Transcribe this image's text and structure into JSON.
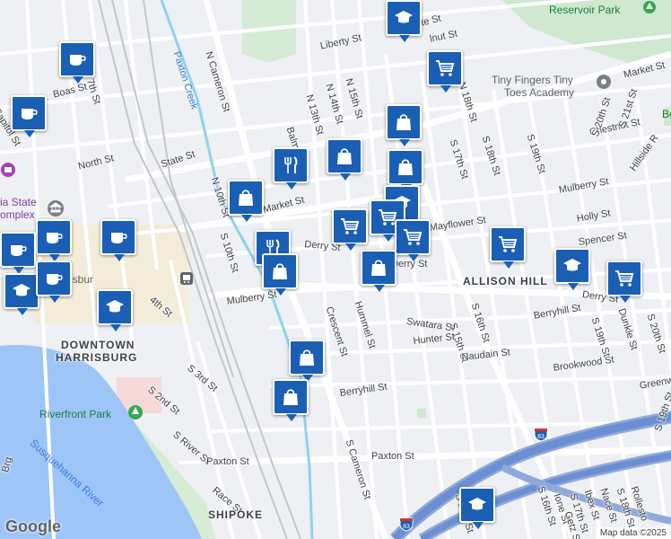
{
  "map": {
    "attribution": "Map data ©2025",
    "logo": "Google",
    "streets": {
      "liberty_st": "Liberty St",
      "state_st_top": "State St",
      "state_st": "State St",
      "n_cameron_st": "N Cameron St",
      "paxton_creek": "Paxton Creek",
      "boas_st": "Boas St",
      "capitol_st": "Capitol St",
      "n_7th_st": "N 7th St",
      "north_st": "North St",
      "n_13th_st": "N 13th St",
      "n_14th_st": "N 14th St",
      "n_15th_st": "N 15th St",
      "walnut_st": "lnut St",
      "balm_st": "Balm",
      "n_18th_st": "N 18th St",
      "s_17th_st": "S 17th St",
      "s_18th_st": "S 18th St",
      "chestnut_st": "Chestnut St",
      "s_19th_st": "S 19th St",
      "s_20th_st": "S 20th St",
      "s_21st_st": "S 21st St",
      "market_st_right": "Market St",
      "market_st": "Market St",
      "mulberry_st_right": "Mulberry St",
      "hillside_rd": "Hillside R",
      "holly_st": "Holly St",
      "mayflower_st": "Mayflower St",
      "spencer_st": "Spencer St",
      "derry_st": "Derry St",
      "derry_st_mid": "Derry St",
      "derry_st_right": "Derry St",
      "s_10th_st": "S 10th St",
      "n_10th_st": "N 10th St",
      "mulberry_st": "Mulberry St",
      "s_4th_st": "4th St",
      "crescent_st": "Crescent St",
      "hummel_st": "Hummel St",
      "swatara_st": "Swatara St",
      "s_16th_st": "S 16th St",
      "s_15th_st": "S 15th St",
      "hunter_st": "Hunter St",
      "berryhill_st_right": "Berryhill St",
      "naudain_st": "Naudain St",
      "brookwood_st": "Brookwood St",
      "s_19th_st_lower": "S 19th St",
      "dunkle_st": "Dunkle St",
      "s_20th_st_lower": "S 20th St",
      "greenwood_st": "Greenw",
      "s_3rd_st": "S 3rd St",
      "s_2nd_st": "S 2nd St",
      "berryhill_st": "Berryhill St",
      "s_river_st": "S River St",
      "paxton_st_left": "Paxton St",
      "paxton_st": "Paxton St",
      "race_st": "Race St",
      "s_cameron_st": "S Cameron St",
      "s_13th_st": "S 13th St",
      "s_16th_st_lower": "S 16th St",
      "ione_st": "Ione St",
      "s_17th_st_lower": "S 17th St",
      "ibex_st": "Ibex St",
      "getz_st": "Getz St",
      "nace_st": "Nace St",
      "s_18th_st_lower": "S 18th St",
      "s_19th_st_bottom": "S 19th St",
      "rolleston_st": "Rollesto",
      "bridge": "Brg"
    },
    "areas": {
      "downtown_line1": "DOWNTOWN",
      "downtown_line2": "HARRISBURG",
      "allison_hill": "ALLISON HILL",
      "shipoke": "SHIPOKE"
    },
    "water": {
      "river": "Susquehanna River"
    },
    "parks": {
      "reservoir_park": "Reservoir Park",
      "riverfront_park": "Riverfront Park",
      "right_edge": "Be"
    },
    "pois": {
      "tiny_fingers_line1": "Tiny Fingers Tiny",
      "tiny_fingers_line2": "Toes Academy",
      "capitol_line1": "ia State",
      "capitol_line2": "omplex",
      "harrisburg_partial": "isbur"
    },
    "highways": {
      "i83_east": "83",
      "i83_south": "83"
    },
    "pins": [
      {
        "type": "education",
        "icon": "graduation-cap-icon"
      },
      {
        "type": "cafe",
        "icon": "coffee-cup-icon"
      },
      {
        "type": "cafe",
        "icon": "coffee-cup-icon"
      },
      {
        "type": "shopping",
        "icon": "shopping-cart-icon"
      },
      {
        "type": "store",
        "icon": "shopping-bag-icon"
      },
      {
        "type": "store",
        "icon": "shopping-bag-icon"
      },
      {
        "type": "store",
        "icon": "shopping-bag-icon"
      },
      {
        "type": "restaurant",
        "icon": "fork-knife-icon"
      },
      {
        "type": "store",
        "icon": "shopping-bag-icon"
      },
      {
        "type": "education",
        "icon": "graduation-cap-icon"
      },
      {
        "type": "shopping",
        "icon": "shopping-cart-icon"
      },
      {
        "type": "shopping",
        "icon": "shopping-cart-icon"
      },
      {
        "type": "shopping",
        "icon": "shopping-cart-icon"
      },
      {
        "type": "restaurant",
        "icon": "fork-knife-icon"
      },
      {
        "type": "store",
        "icon": "shopping-bag-icon"
      },
      {
        "type": "store",
        "icon": "shopping-bag-icon"
      },
      {
        "type": "shopping",
        "icon": "shopping-cart-icon"
      },
      {
        "type": "education",
        "icon": "graduation-cap-icon"
      },
      {
        "type": "shopping",
        "icon": "shopping-cart-icon"
      },
      {
        "type": "cafe",
        "icon": "coffee-cup-icon"
      },
      {
        "type": "cafe",
        "icon": "coffee-cup-icon"
      },
      {
        "type": "cafe",
        "icon": "coffee-cup-icon"
      },
      {
        "type": "education",
        "icon": "graduation-cap-icon"
      },
      {
        "type": "education",
        "icon": "graduation-cap-icon"
      },
      {
        "type": "cafe",
        "icon": "coffee-cup-icon"
      },
      {
        "type": "store",
        "icon": "shopping-bag-icon"
      },
      {
        "type": "store",
        "icon": "shopping-bag-icon"
      },
      {
        "type": "education",
        "icon": "graduation-cap-icon"
      }
    ],
    "colors": {
      "pin": "#1a5fb4",
      "water": "#9ec5f8",
      "park": "#c8e6c9",
      "highway": "#6b8fd1",
      "creek": "#8fd3e8"
    }
  }
}
